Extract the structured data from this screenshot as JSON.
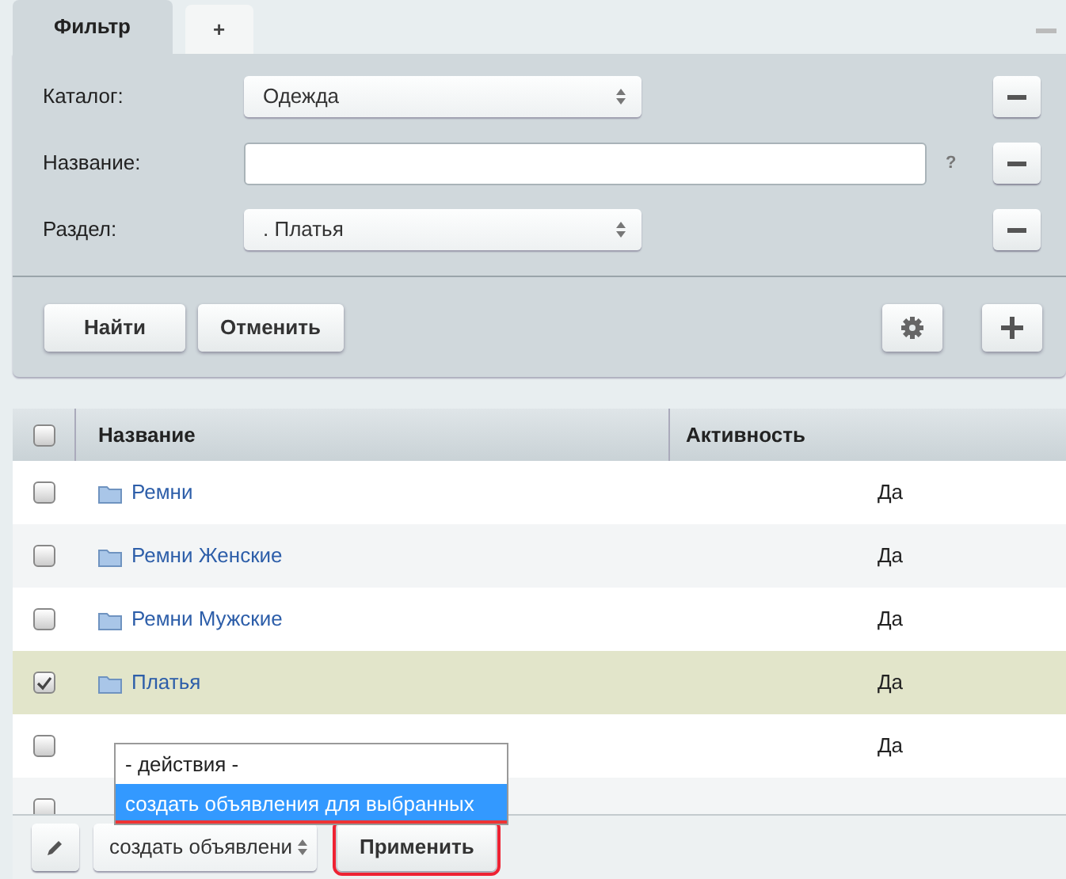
{
  "filter": {
    "tabs": [
      {
        "label": "Фильтр",
        "selected": true
      },
      {
        "label": "+",
        "selected": false
      }
    ],
    "fields": [
      {
        "kind": "select",
        "label": "Каталог:",
        "value": "Одежда"
      },
      {
        "kind": "text",
        "label": "Название:",
        "hint": "?"
      },
      {
        "kind": "select",
        "label": "Раздел:",
        "value": ". Платья"
      }
    ],
    "buttons": [
      "Найти",
      "Отменить"
    ]
  },
  "table": {
    "columns": [
      "Название",
      "Активность"
    ],
    "header_checked": false,
    "rows": [
      {
        "name": "Ремни",
        "active": "Да",
        "checked": false
      },
      {
        "name": "Ремни Женские",
        "active": "Да",
        "checked": false
      },
      {
        "name": "Ремни Мужские",
        "active": "Да",
        "checked": false
      },
      {
        "name": "Платья",
        "active": "Да",
        "checked": true
      },
      {
        "active": "Да",
        "checked": false
      },
      {
        "checked": false
      }
    ]
  },
  "action_bar": {
    "select_value": "создать объявлени",
    "apply": "Применить",
    "dropdown": [
      {
        "label": "- действия -",
        "selected": false
      },
      {
        "label": "создать объявления для выбранных",
        "selected": true
      }
    ]
  }
}
